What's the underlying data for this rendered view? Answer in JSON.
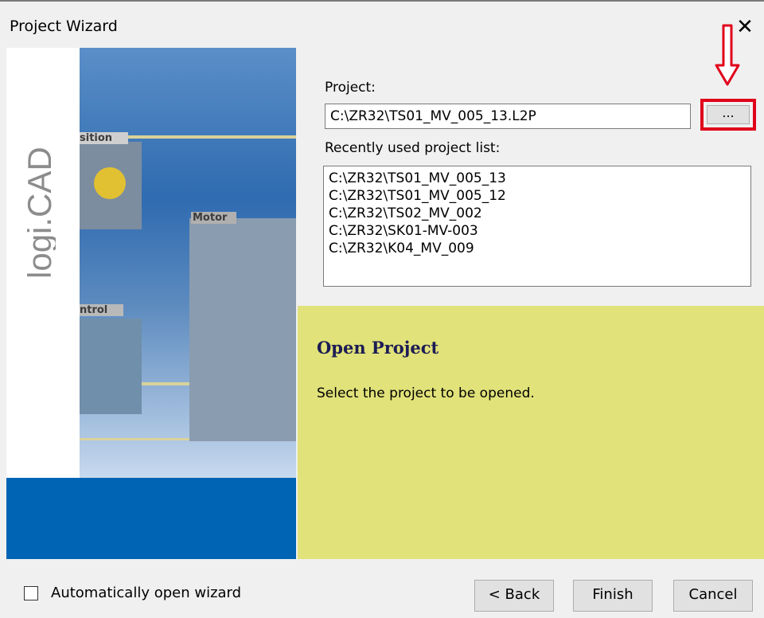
{
  "window": {
    "title": "Project Wizard",
    "close": "✕"
  },
  "banner": {
    "logo_text": "logi.CAD",
    "captions": [
      "sition",
      "Motor",
      "ntrol"
    ]
  },
  "project": {
    "label": "Project:",
    "value": "C:\\ZR32\\TS01_MV_005_13.L2P",
    "browse_label": "...",
    "recent_label": "Recently used project list:",
    "recent": [
      "C:\\ZR32\\TS01_MV_005_13",
      "C:\\ZR32\\TS01_MV_005_12",
      "C:\\ZR32\\TS02_MV_002",
      "C:\\ZR32\\SK01-MV-003",
      "C:\\ZR32\\K04_MV_009"
    ]
  },
  "info": {
    "heading": "Open Project",
    "text": "Select the project to be opened."
  },
  "footer": {
    "auto_open_label": "Automatically open wizard",
    "back_label": "< Back",
    "finish_label": "Finish",
    "cancel_label": "Cancel"
  },
  "colors": {
    "banner_blue": "#0064b4",
    "info_bg": "#e1e279",
    "highlight": "#e0001b"
  }
}
